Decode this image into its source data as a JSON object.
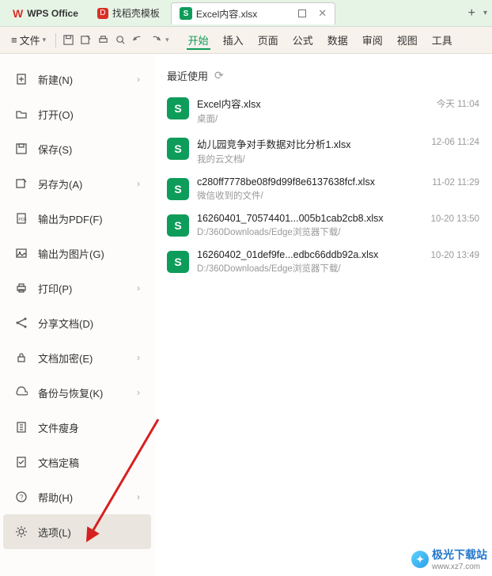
{
  "tabs": {
    "app": "WPS Office",
    "template": "找稻壳模板",
    "doc": "Excel内容.xlsx"
  },
  "toolbar": {
    "file": "文件"
  },
  "menu": {
    "start": "开始",
    "insert": "插入",
    "page": "页面",
    "formula": "公式",
    "data": "数据",
    "review": "审阅",
    "view": "视图",
    "tools": "工具"
  },
  "sidebar": {
    "new": "新建(N)",
    "open": "打开(O)",
    "save": "保存(S)",
    "saveas": "另存为(A)",
    "exportpdf": "输出为PDF(F)",
    "exportimg": "输出为图片(G)",
    "print": "打印(P)",
    "share": "分享文档(D)",
    "encrypt": "文档加密(E)",
    "backup": "备份与恢复(K)",
    "slim": "文件瘦身",
    "final": "文档定稿",
    "help": "帮助(H)",
    "options": "选项(L)"
  },
  "content": {
    "recent": "最近使用",
    "files": [
      {
        "name": "Excel内容.xlsx",
        "path": "桌面/",
        "time": "今天  11:04"
      },
      {
        "name": "幼儿园竞争对手数据对比分析1.xlsx",
        "path": "我的云文档/",
        "time": "12-06  11:24"
      },
      {
        "name": "c280ff7778be08f9d99f8e6137638fcf.xlsx",
        "path": "微信收到的文件/",
        "time": "11-02  11:29"
      },
      {
        "name": "16260401_70574401...005b1cab2cb8.xlsx",
        "path": "D:/360Downloads/Edge浏览器下载/",
        "time": "10-20  13:50"
      },
      {
        "name": "16260402_01def9fe...edbc66ddb92a.xlsx",
        "path": "D:/360Downloads/Edge浏览器下载/",
        "time": "10-20  13:49"
      }
    ]
  },
  "watermark": {
    "title": "极光下载站",
    "url": "www.xz7.com"
  }
}
